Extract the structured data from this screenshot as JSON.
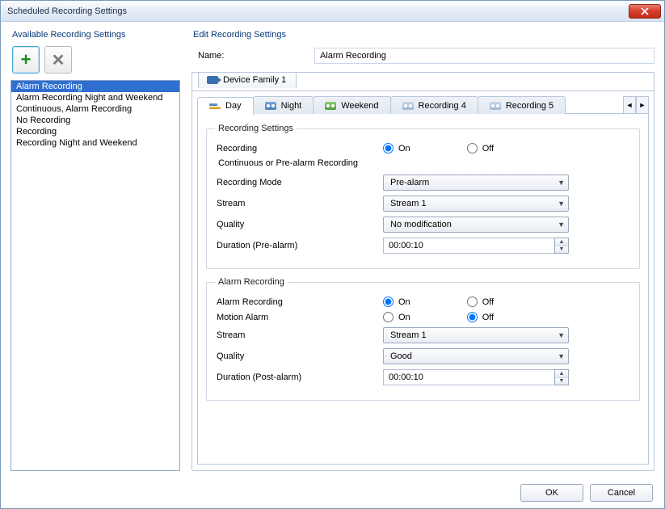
{
  "window": {
    "title": "Scheduled Recording Settings"
  },
  "left": {
    "group_label": "Available Recording Settings",
    "add_tooltip": "Add",
    "delete_tooltip": "Delete",
    "items": [
      "Alarm Recording",
      "Alarm Recording Night and Weekend",
      "Continuous, Alarm Recording",
      "No Recording",
      "Recording",
      "Recording Night and Weekend"
    ],
    "selected_index": 0
  },
  "right": {
    "group_label": "Edit Recording Settings",
    "name_label": "Name:",
    "name_value": "Alarm Recording",
    "outer_tab": "Device Family 1",
    "inner_tabs": [
      "Day",
      "Night",
      "Weekend",
      "Recording 4",
      "Recording 5"
    ],
    "active_inner_tab": 0
  },
  "recording_settings": {
    "legend": "Recording Settings",
    "recording_label": "Recording",
    "on_label": "On",
    "off_label": "Off",
    "recording_on": true,
    "subhead": "Continuous or Pre-alarm Recording",
    "mode_label": "Recording Mode",
    "mode_value": "Pre-alarm",
    "stream_label": "Stream",
    "stream_value": "Stream 1",
    "quality_label": "Quality",
    "quality_value": "No modification",
    "duration_label": "Duration (Pre-alarm)",
    "duration_value": "00:00:10"
  },
  "alarm_recording": {
    "legend": "Alarm Recording",
    "alarm_label": "Alarm Recording",
    "on_label": "On",
    "off_label": "Off",
    "alarm_on": true,
    "motion_label": "Motion Alarm",
    "motion_on": false,
    "stream_label": "Stream",
    "stream_value": "Stream 1",
    "quality_label": "Quality",
    "quality_value": "Good",
    "duration_label": "Duration (Post-alarm)",
    "duration_value": "00:00:10"
  },
  "buttons": {
    "ok": "OK",
    "cancel": "Cancel"
  }
}
